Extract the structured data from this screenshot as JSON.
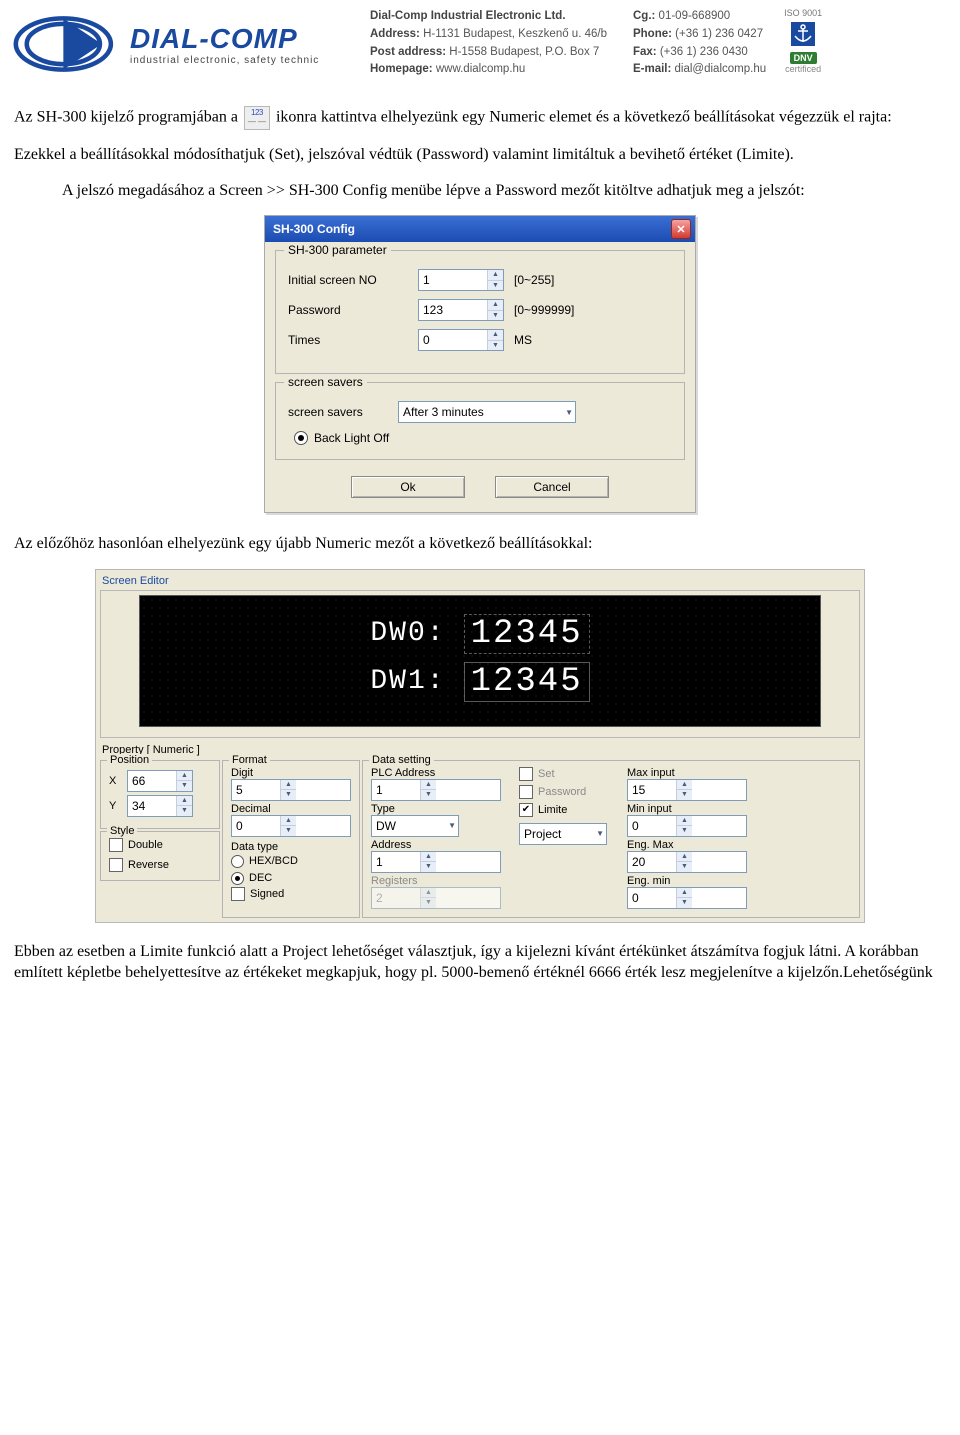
{
  "header": {
    "brand": "DIAL-COMP",
    "tagline": "industrial electronic, safety technic",
    "col1": {
      "name_lbl": "Dial-Comp Industrial Electronic Ltd.",
      "address_lbl": "Address:",
      "address_val": "H-1131 Budapest, Keszkenő u. 46/b",
      "post_lbl": "Post address:",
      "post_val": "H-1558 Budapest, P.O. Box 7",
      "home_lbl": "Homepage:",
      "home_val": "www.dialcomp.hu"
    },
    "col2": {
      "cg_lbl": "Cg.:",
      "cg_val": "01-09-668900",
      "phone_lbl": "Phone:",
      "phone_val": "(+36 1) 236 0427",
      "fax_lbl": "Fax:",
      "fax_val": "(+36 1) 236 0430",
      "email_lbl": "E-mail:",
      "email_val": "dial@dialcomp.hu"
    },
    "cert": {
      "iso": "ISO 9001",
      "dnv": "DNV",
      "sub": "certificed"
    }
  },
  "body": {
    "p1a": "Az SH-300 kijelző programjában a ",
    "p1b": "ikonra kattintva elhelyezünk egy Numeric elemet és a következő beállításokat végezzük el rajta:",
    "p2": "Ezekkel a beállításokkal módosíthatjuk (Set), jelszóval védtük (Password) valamint limitáltuk a bevihető értéket (Limite).",
    "p3": "A jelszó megadásához a Screen >> SH-300 Config menübe lépve a  Password mezőt kitöltve adhatjuk meg a jelszót:",
    "p4": "Az előzőhöz hasonlóan elhelyezünk egy újabb Numeric mezőt a következő beállításokkal:",
    "p5": "Ebben az esetben a  Limite funkció alatt a Project lehetőséget választjuk, így a kijelezni kívánt értékünket átszámítva fogjuk látni. A korábban említett képletbe behelyettesítve az értékeket megkapjuk, hogy pl. 5000-bemenő értéknél 6666 érték lesz megjelenítve a kijelzőn.Lehetőségünk"
  },
  "dialog": {
    "title": "SH-300 Config",
    "grp_param": "SH-300 parameter",
    "initial_lbl": "Initial screen NO",
    "initial_val": "1",
    "initial_hint": "[0~255]",
    "password_lbl": "Password",
    "password_val": "123",
    "password_hint": "[0~999999]",
    "times_lbl": "Times",
    "times_val": "0",
    "times_unit": "MS",
    "grp_savers": "screen savers",
    "savers_lbl": "screen savers",
    "savers_val": "After 3 minutes",
    "backlight_lbl": "Back Light Off",
    "ok": "Ok",
    "cancel": "Cancel"
  },
  "editor": {
    "title": "Screen Editor",
    "row0_lbl": "DW0:",
    "row0_val": "12345",
    "row1_lbl": "DW1:",
    "row1_val": "12345",
    "prop_title": "Property [ Numeric ]",
    "position": {
      "title": "Position",
      "x_lbl": "X",
      "x_val": "66",
      "y_lbl": "Y",
      "y_val": "34"
    },
    "style": {
      "title": "Style",
      "double": "Double",
      "reverse": "Reverse"
    },
    "format": {
      "title": "Format",
      "digit_lbl": "Digit",
      "digit_val": "5",
      "decimal_lbl": "Decimal",
      "decimal_val": "0",
      "dtype_lbl": "Data type",
      "hex": "HEX/BCD",
      "dec": "DEC",
      "signed": "Signed"
    },
    "data": {
      "title": "Data setting",
      "plc_lbl": "PLC Address",
      "plc_val": "1",
      "type_lbl": "Type",
      "type_val": "DW",
      "addr_lbl": "Address",
      "addr_val": "1",
      "reg_lbl": "Registers",
      "reg_val": "2"
    },
    "opts": {
      "set": "Set",
      "pwd": "Password",
      "lim": "Limite",
      "proj": "Project"
    },
    "limits": {
      "max_lbl": "Max input",
      "max_val": "15",
      "min_lbl": "Min input",
      "min_val": "0",
      "emax_lbl": "Eng. Max",
      "emax_val": "20",
      "emin_lbl": "Eng. min",
      "emin_val": "0"
    }
  }
}
